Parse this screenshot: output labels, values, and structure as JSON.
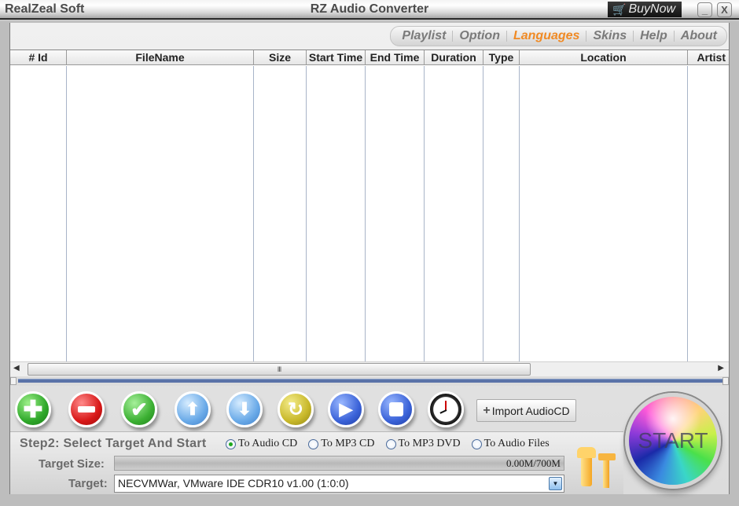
{
  "titlebar": {
    "brand": "RealZeal Soft",
    "title": "RZ Audio Converter",
    "buy_now": "BuyNow",
    "minimize": "_",
    "close": "X"
  },
  "menu": {
    "items": [
      {
        "label": "Playlist",
        "active": false
      },
      {
        "label": "Option",
        "active": false
      },
      {
        "label": "Languages",
        "active": true
      },
      {
        "label": "Skins",
        "active": false
      },
      {
        "label": "Help",
        "active": false
      },
      {
        "label": "About",
        "active": false
      }
    ]
  },
  "table": {
    "columns": [
      "# Id",
      "FileName",
      "Size",
      "Start Time",
      "End Time",
      "Duration",
      "Type",
      "Location",
      "Artist"
    ],
    "rows": []
  },
  "scrollbar": {
    "thumb_grip": "III"
  },
  "toolbar": {
    "buttons": [
      "add",
      "remove",
      "check",
      "move-up",
      "move-down",
      "refresh",
      "play",
      "stop",
      "schedule"
    ],
    "import_label": "Import AudioCD"
  },
  "step2": {
    "label": "Step2: Select Target And Start",
    "options": [
      {
        "label": "To Audio CD",
        "checked": true
      },
      {
        "label": "To MP3 CD",
        "checked": false
      },
      {
        "label": "To MP3 DVD",
        "checked": false
      },
      {
        "label": "To Audio Files",
        "checked": false
      }
    ],
    "target_size_label": "Target Size:",
    "target_size_value": "0.00M/700M",
    "target_label": "Target:",
    "target_value": "NECVMWar, VMware IDE CDR10 v1.00 (1:0:0)"
  },
  "start": {
    "label": "START"
  },
  "colors": {
    "accent_active_menu": "#f08a24",
    "progress_track": "#5a73a8",
    "radio_checked": "#1ea81e"
  }
}
